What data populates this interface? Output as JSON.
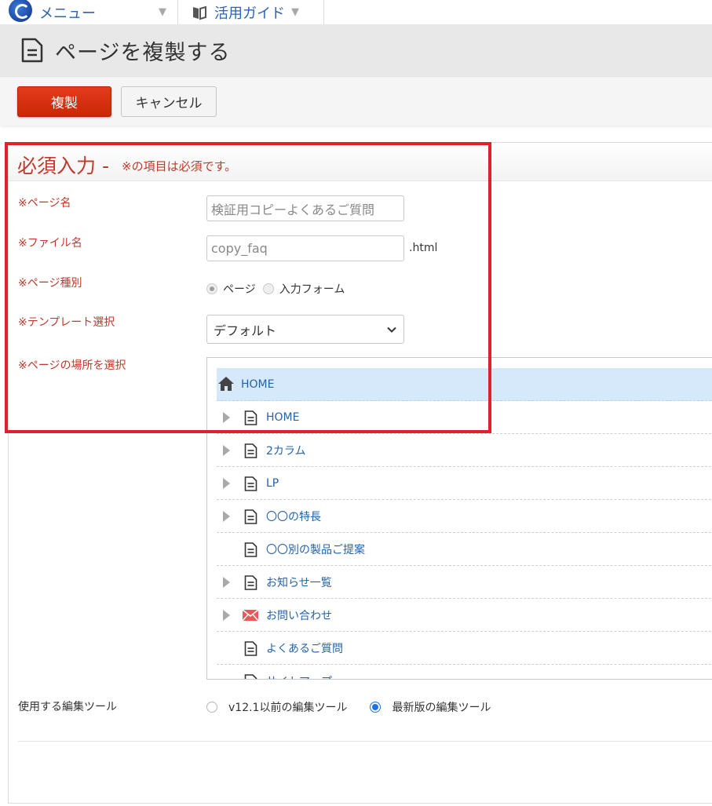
{
  "topnav": {
    "menu_label": "メニュー",
    "guide_label": "活用ガイド",
    "caret": "▼"
  },
  "header": {
    "title": "ページを複製する"
  },
  "toolbar": {
    "copy_label": "複製",
    "cancel_label": "キャンセル"
  },
  "panel": {
    "title": "必須入力 -",
    "note": "※の項目は必須です。"
  },
  "form": {
    "page_name_label": "※ページ名",
    "page_name_value": "検証用コピーよくあるご質問",
    "file_name_label": "※ファイル名",
    "file_name_value": "copy_faq",
    "file_ext": ".html",
    "page_type_label": "※ページ種別",
    "page_type_options": [
      "ページ",
      "入力フォーム"
    ],
    "page_type_selected": "ページ",
    "template_label": "※テンプレート選択",
    "template_value": "デフォルト",
    "location_label": "※ページの場所を選択"
  },
  "tree": {
    "root": "HOME",
    "items": [
      {
        "label": "HOME",
        "expandable": true,
        "icon": "page-icon"
      },
      {
        "label": "2カラム",
        "expandable": true,
        "icon": "page-icon"
      },
      {
        "label": "LP",
        "expandable": true,
        "icon": "page-icon"
      },
      {
        "label": "〇〇の特長",
        "expandable": true,
        "icon": "page-icon"
      },
      {
        "label": "〇〇別の製品ご提案",
        "expandable": false,
        "icon": "page-icon"
      },
      {
        "label": "お知らせ一覧",
        "expandable": true,
        "icon": "page-icon"
      },
      {
        "label": "お問い合わせ",
        "expandable": true,
        "icon": "mail-icon"
      },
      {
        "label": "よくあるご質問",
        "expandable": false,
        "icon": "page-icon"
      },
      {
        "label": "サイトマップ",
        "expandable": false,
        "icon": "page-icon"
      }
    ]
  },
  "editor_tool": {
    "label": "使用する編集ツール",
    "options": [
      "v12.1以前の編集ツール",
      "最新版の編集ツール"
    ],
    "selected": "最新版の編集ツール"
  },
  "colors": {
    "required_red": "#c0392b",
    "link_blue": "#2463a8",
    "copy_button": "#d9300f",
    "highlight_border": "#e0202c",
    "tree_selected": "#d6e9fb"
  }
}
